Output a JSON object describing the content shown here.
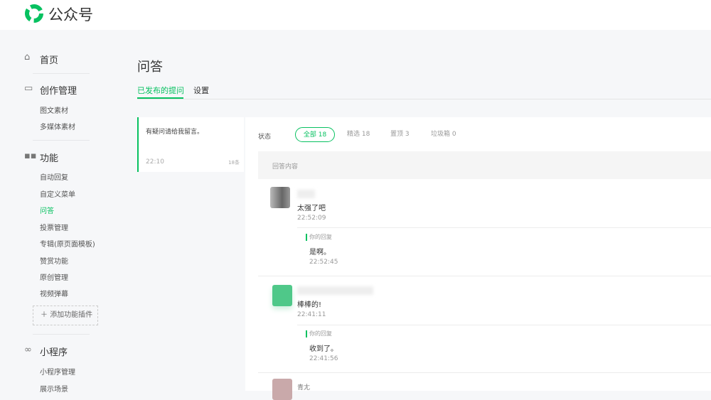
{
  "header": {
    "brand": "公众号",
    "brand_color": "#07c160"
  },
  "sidebar": {
    "home": "首页",
    "creation": {
      "label": "创作管理",
      "items": [
        "图文素材",
        "多媒体素材"
      ]
    },
    "features": {
      "label": "功能",
      "items": [
        "自动回复",
        "自定义菜单",
        "问答",
        "投票管理",
        "专辑(原页面模板)",
        "赞赏功能",
        "原创管理",
        "视频弹幕"
      ],
      "active": "问答",
      "add_plugin": "添加功能插件"
    },
    "miniprogram": {
      "label": "小程序",
      "items": [
        "小程序管理",
        "展示场景"
      ]
    }
  },
  "main": {
    "title": "问答",
    "tabs": [
      "已发布的提问",
      "设置"
    ],
    "question": {
      "text": "有疑问请给我留言。",
      "time": "22:10",
      "count": "18条"
    },
    "status_label": "状态",
    "filters": [
      {
        "label": "全部",
        "count": "18"
      },
      {
        "label": "精选",
        "count": "18"
      },
      {
        "label": "置顶",
        "count": "3"
      },
      {
        "label": "垃圾箱",
        "count": "0"
      }
    ],
    "column_header": "回答内容",
    "comments": [
      {
        "text": "太强了吧",
        "time": "22:52:09",
        "reply_label": "你的回复",
        "reply": "是啊。",
        "reply_time": "22:52:45"
      },
      {
        "text": "棒棒的!",
        "time": "22:41:11",
        "reply_label": "你的回复",
        "reply": "收到了。",
        "reply_time": "22:41:56"
      },
      {
        "name": "青尢"
      }
    ]
  }
}
